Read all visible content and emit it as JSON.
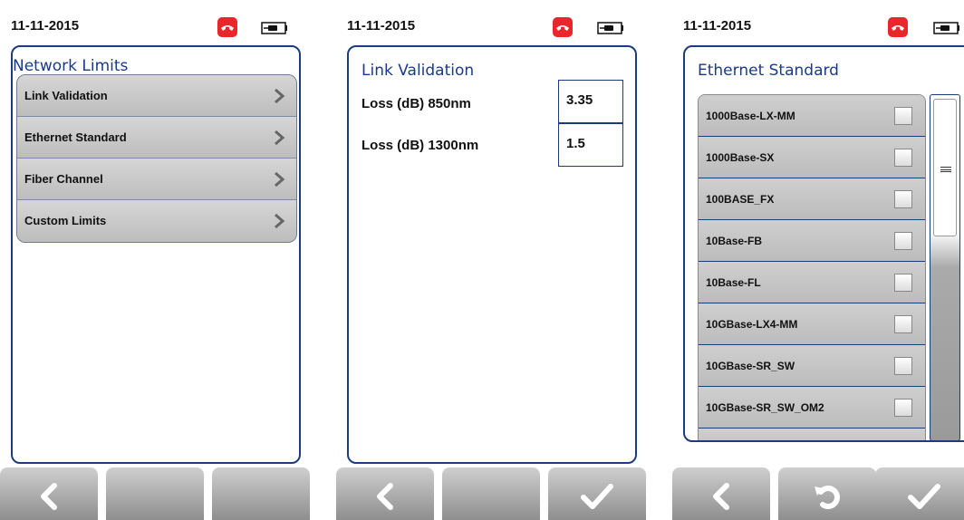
{
  "screens": [
    {
      "date": "11-11-2015",
      "title": "Network Limits",
      "menu_items": [
        {
          "label": "Link Validation"
        },
        {
          "label": "Ethernet Standard"
        },
        {
          "label": "Fiber Channel"
        },
        {
          "label": "Custom Limits"
        }
      ]
    },
    {
      "date": "11-11-2015",
      "title": "Link Validation",
      "rows": [
        {
          "label": "Loss (dB) 850nm",
          "value": "3.35"
        },
        {
          "label": "Loss (dB) 1300nm",
          "value": "1.5"
        }
      ]
    },
    {
      "date": "11-11-2015",
      "title": "Ethernet Standard",
      "standards": [
        {
          "label": "1000Base-LX-MM",
          "checked": false
        },
        {
          "label": "1000Base-SX",
          "checked": false
        },
        {
          "label": "100BASE_FX",
          "checked": false
        },
        {
          "label": "10Base-FB",
          "checked": false
        },
        {
          "label": "10Base-FL",
          "checked": false
        },
        {
          "label": "10GBase-LX4-MM",
          "checked": false
        },
        {
          "label": "10GBase-SR_SW",
          "checked": false
        },
        {
          "label": "10GBase-SR_SW_OM2",
          "checked": false
        }
      ]
    }
  ],
  "icons": {
    "status_alert": "phone-hangup-icon",
    "battery": "battery-plug-icon",
    "back": "chevron-left-icon",
    "confirm": "checkmark-icon",
    "reset": "undo-icon",
    "menu_arrow": "chevron-right-icon"
  },
  "colors": {
    "accent": "#1c3d7c",
    "title_text": "#1a3a8a",
    "alert": "#e8262b",
    "menu_item_bg": "#c8c8c8"
  }
}
